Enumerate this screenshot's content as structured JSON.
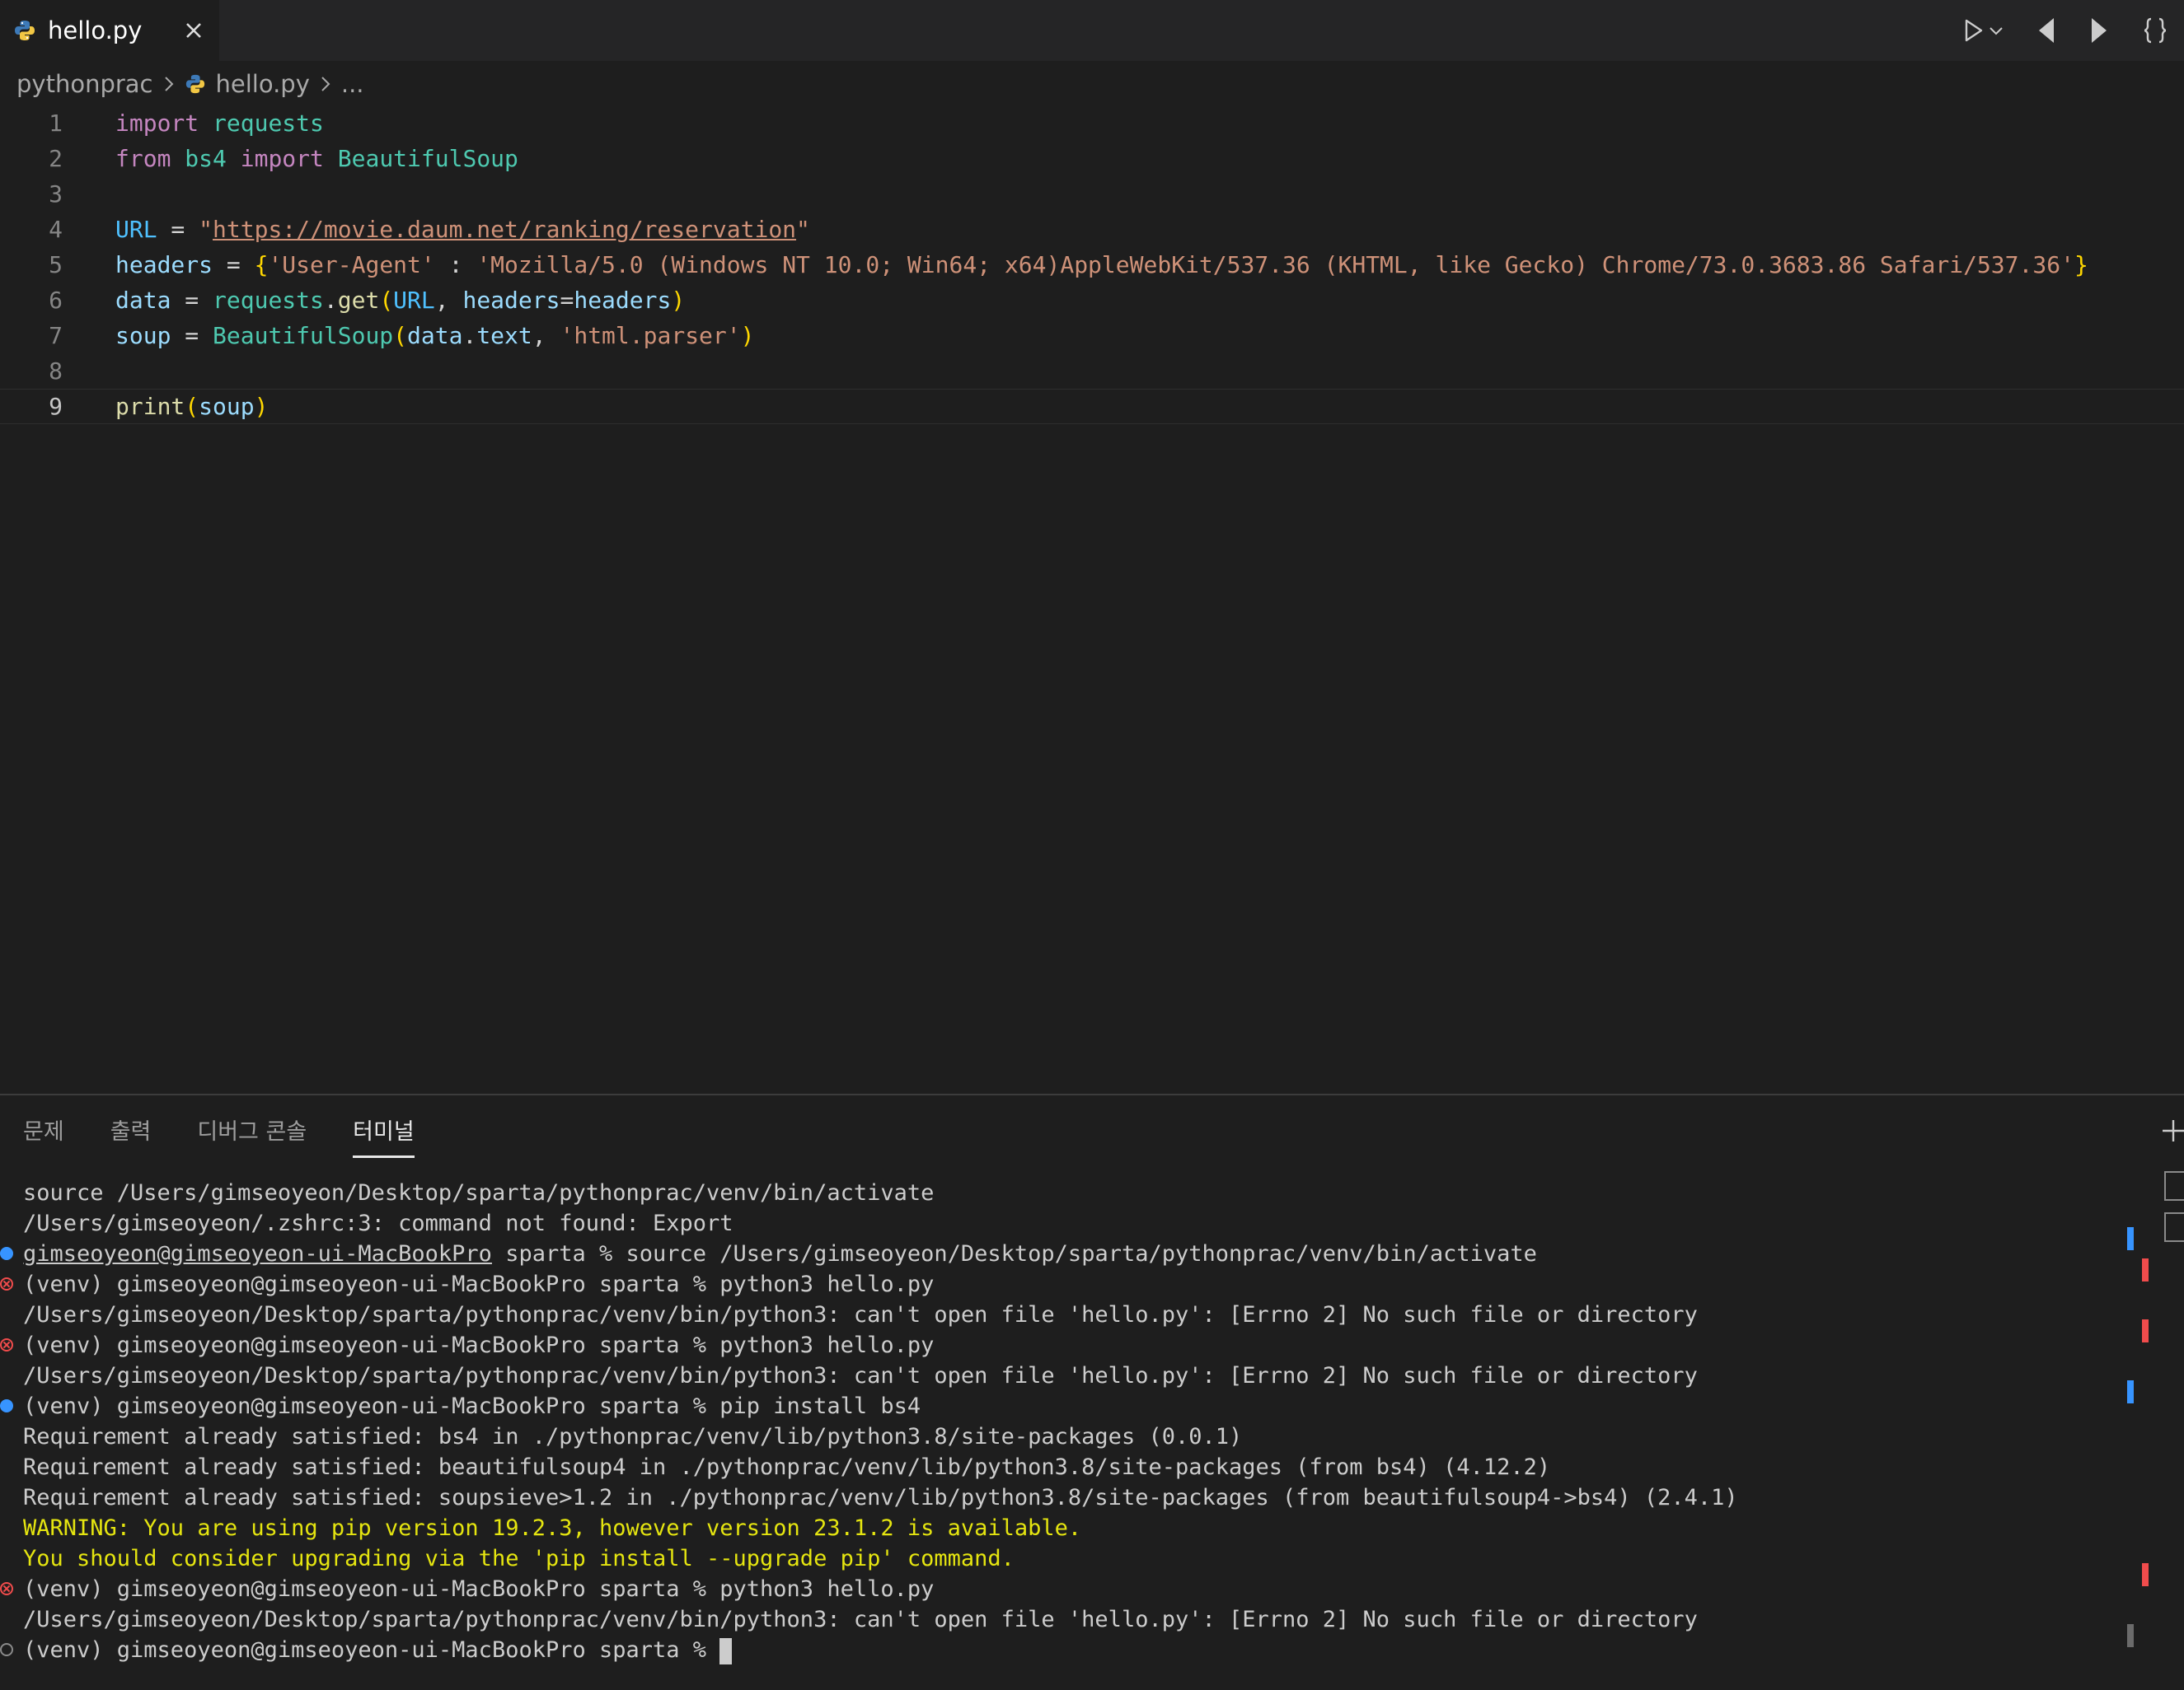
{
  "tab": {
    "file_name": "hello.py"
  },
  "breadcrumb": {
    "folder": "pythonprac",
    "file": "hello.py",
    "more": "..."
  },
  "editor": {
    "current_line": 9,
    "lines": [
      {
        "n": "1",
        "tokens": [
          {
            "t": "import",
            "c": "kw"
          },
          {
            "t": " ",
            "c": ""
          },
          {
            "t": "requests",
            "c": "mod"
          }
        ]
      },
      {
        "n": "2",
        "tokens": [
          {
            "t": "from",
            "c": "kw"
          },
          {
            "t": " ",
            "c": ""
          },
          {
            "t": "bs4",
            "c": "mod"
          },
          {
            "t": " ",
            "c": ""
          },
          {
            "t": "import",
            "c": "kw"
          },
          {
            "t": " ",
            "c": ""
          },
          {
            "t": "BeautifulSoup",
            "c": "cls"
          }
        ]
      },
      {
        "n": "3",
        "tokens": []
      },
      {
        "n": "4",
        "tokens": [
          {
            "t": "URL",
            "c": "const"
          },
          {
            "t": " = ",
            "c": "op"
          },
          {
            "t": "\"",
            "c": "str"
          },
          {
            "t": "https://movie.daum.net/ranking/reservation",
            "c": "url"
          },
          {
            "t": "\"",
            "c": "str"
          }
        ]
      },
      {
        "n": "5",
        "tokens": [
          {
            "t": "headers",
            "c": "var"
          },
          {
            "t": " = ",
            "c": "op"
          },
          {
            "t": "{",
            "c": "br1"
          },
          {
            "t": "'User-Agent'",
            "c": "str"
          },
          {
            "t": " : ",
            "c": "op"
          },
          {
            "t": "'Mozilla/5.0 (Windows NT 10.0; Win64; x64)AppleWebKit/537.36 (KHTML, like Gecko) Chrome/73.0.3683.86 Safari/537.36'",
            "c": "str"
          },
          {
            "t": "}",
            "c": "br1"
          }
        ]
      },
      {
        "n": "6",
        "tokens": [
          {
            "t": "data",
            "c": "var"
          },
          {
            "t": " = ",
            "c": "op"
          },
          {
            "t": "requests",
            "c": "mod"
          },
          {
            "t": ".",
            "c": "op"
          },
          {
            "t": "get",
            "c": "fn"
          },
          {
            "t": "(",
            "c": "br1"
          },
          {
            "t": "URL",
            "c": "const"
          },
          {
            "t": ", ",
            "c": "op"
          },
          {
            "t": "headers",
            "c": "var"
          },
          {
            "t": "=",
            "c": "op"
          },
          {
            "t": "headers",
            "c": "var"
          },
          {
            "t": ")",
            "c": "br1"
          }
        ]
      },
      {
        "n": "7",
        "tokens": [
          {
            "t": "soup",
            "c": "var"
          },
          {
            "t": " = ",
            "c": "op"
          },
          {
            "t": "BeautifulSoup",
            "c": "cls"
          },
          {
            "t": "(",
            "c": "br1"
          },
          {
            "t": "data",
            "c": "var"
          },
          {
            "t": ".",
            "c": "op"
          },
          {
            "t": "text",
            "c": "var"
          },
          {
            "t": ", ",
            "c": "op"
          },
          {
            "t": "'html.parser'",
            "c": "str"
          },
          {
            "t": ")",
            "c": "br1"
          }
        ]
      },
      {
        "n": "8",
        "tokens": []
      },
      {
        "n": "9",
        "tokens": [
          {
            "t": "print",
            "c": "fn"
          },
          {
            "t": "(",
            "c": "br1"
          },
          {
            "t": "soup",
            "c": "var"
          },
          {
            "t": ")",
            "c": "br1"
          }
        ]
      }
    ]
  },
  "panel": {
    "tabs": [
      {
        "label": "문제",
        "active": false
      },
      {
        "label": "출력",
        "active": false
      },
      {
        "label": "디버그 콘솔",
        "active": false
      },
      {
        "label": "터미널",
        "active": true
      }
    ]
  },
  "terminal": {
    "lines": [
      {
        "deco": "",
        "style": "",
        "text": "source /Users/gimseoyeon/Desktop/sparta/pythonprac/venv/bin/activate"
      },
      {
        "deco": "",
        "style": "",
        "text": "/Users/gimseoyeon/.zshrc:3: command not found: Export"
      },
      {
        "deco": "ok",
        "style": "",
        "user": "gimseoyeon@gimseoyeon-ui-MacBookPro",
        "text": " sparta % source /Users/gimseoyeon/Desktop/sparta/pythonprac/venv/bin/activate"
      },
      {
        "deco": "err",
        "style": "",
        "text": "(venv) gimseoyeon@gimseoyeon-ui-MacBookPro sparta % python3 hello.py"
      },
      {
        "deco": "",
        "style": "",
        "text": "/Users/gimseoyeon/Desktop/sparta/pythonprac/venv/bin/python3: can't open file 'hello.py': [Errno 2] No such file or directory"
      },
      {
        "deco": "err",
        "style": "",
        "text": "(venv) gimseoyeon@gimseoyeon-ui-MacBookPro sparta % python3 hello.py"
      },
      {
        "deco": "",
        "style": "",
        "text": "/Users/gimseoyeon/Desktop/sparta/pythonprac/venv/bin/python3: can't open file 'hello.py': [Errno 2] No such file or directory"
      },
      {
        "deco": "ok",
        "style": "",
        "text": "(venv) gimseoyeon@gimseoyeon-ui-MacBookPro sparta % pip install bs4"
      },
      {
        "deco": "",
        "style": "",
        "text": "Requirement already satisfied: bs4 in ./pythonprac/venv/lib/python3.8/site-packages (0.0.1)"
      },
      {
        "deco": "",
        "style": "",
        "text": "Requirement already satisfied: beautifulsoup4 in ./pythonprac/venv/lib/python3.8/site-packages (from bs4) (4.12.2)"
      },
      {
        "deco": "",
        "style": "",
        "text": "Requirement already satisfied: soupsieve>1.2 in ./pythonprac/venv/lib/python3.8/site-packages (from beautifulsoup4->bs4) (2.4.1)"
      },
      {
        "deco": "",
        "style": "warn",
        "text": "WARNING: You are using pip version 19.2.3, however version 23.1.2 is available."
      },
      {
        "deco": "",
        "style": "warn",
        "text": "You should consider upgrading via the 'pip install --upgrade pip' command."
      },
      {
        "deco": "err",
        "style": "",
        "text": "(venv) gimseoyeon@gimseoyeon-ui-MacBookPro sparta % python3 hello.py"
      },
      {
        "deco": "",
        "style": "",
        "text": "/Users/gimseoyeon/Desktop/sparta/pythonprac/venv/bin/python3: can't open file 'hello.py': [Errno 2] No such file or directory"
      },
      {
        "deco": "none",
        "style": "",
        "text": "(venv) gimseoyeon@gimseoyeon-ui-MacBookPro sparta % ",
        "cursor": true
      }
    ]
  },
  "colors": {
    "error": "#f14c4c",
    "success": "#3794ff",
    "warning": "#e5e510"
  },
  "icons": {
    "tab_file": "python-file-icon",
    "tab_close": "close-icon",
    "run": "play-icon",
    "run_menu": "chevron-down-icon",
    "prev_change": "previous-change-icon",
    "next_change": "next-change-icon",
    "braces": "braces-icon",
    "new_terminal": "plus-icon"
  }
}
